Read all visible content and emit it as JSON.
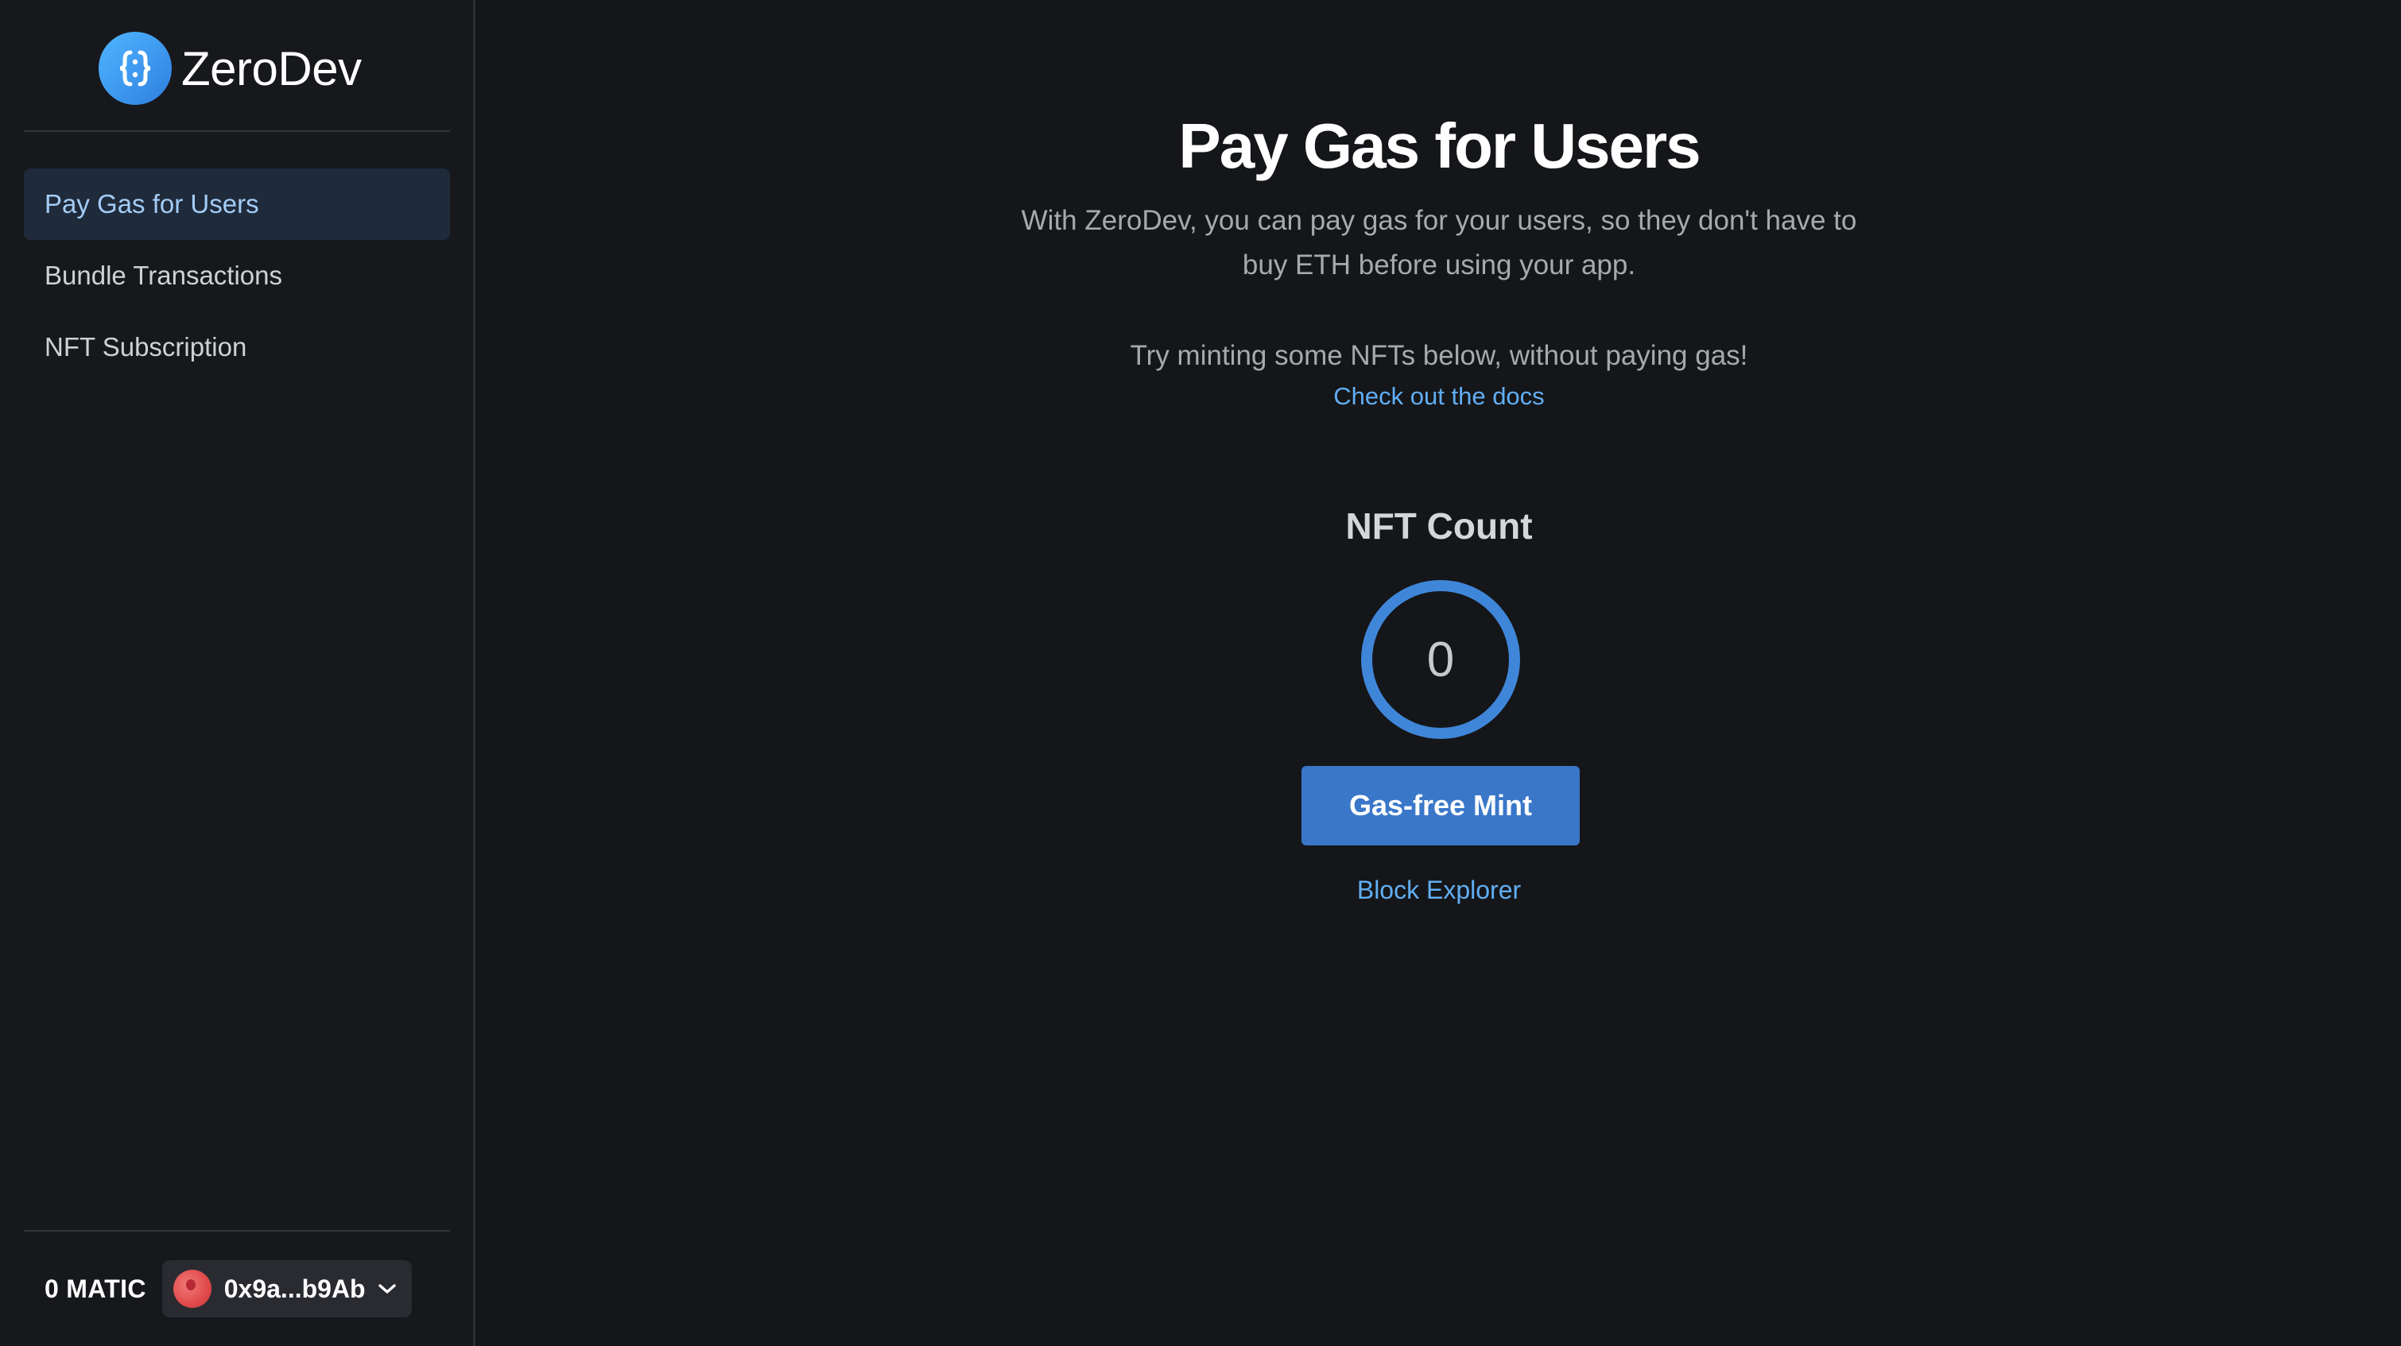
{
  "sidebar": {
    "brand_name": "ZeroDev",
    "items": [
      {
        "label": "Pay Gas for Users",
        "active": true
      },
      {
        "label": "Bundle Transactions",
        "active": false
      },
      {
        "label": "NFT Subscription",
        "active": false
      }
    ],
    "balance": "0 MATIC",
    "wallet_address": "0x9a...b9Ab"
  },
  "main": {
    "title": "Pay Gas for Users",
    "subtitle_line1": "With ZeroDev, you can pay gas for your users, so they don't have to",
    "subtitle_line2": "buy ETH before using your app.",
    "try_text": "Try minting some NFTs below, without paying gas!",
    "docs_link": "Check out the docs",
    "count_heading": "NFT Count",
    "count_value": "0",
    "mint_button": "Gas-free Mint",
    "explorer_link": "Block Explorer"
  },
  "colors": {
    "background": "#151619",
    "sidebar_background": "#17181c",
    "accent": "#3a77c9",
    "link": "#61aef3",
    "active_nav": "#1f2a3b"
  },
  "icons": {
    "brand": "zerodev-logo-icon",
    "wallet_avatar": "wallet-avatar-icon",
    "chevron": "chevron-down-icon"
  }
}
